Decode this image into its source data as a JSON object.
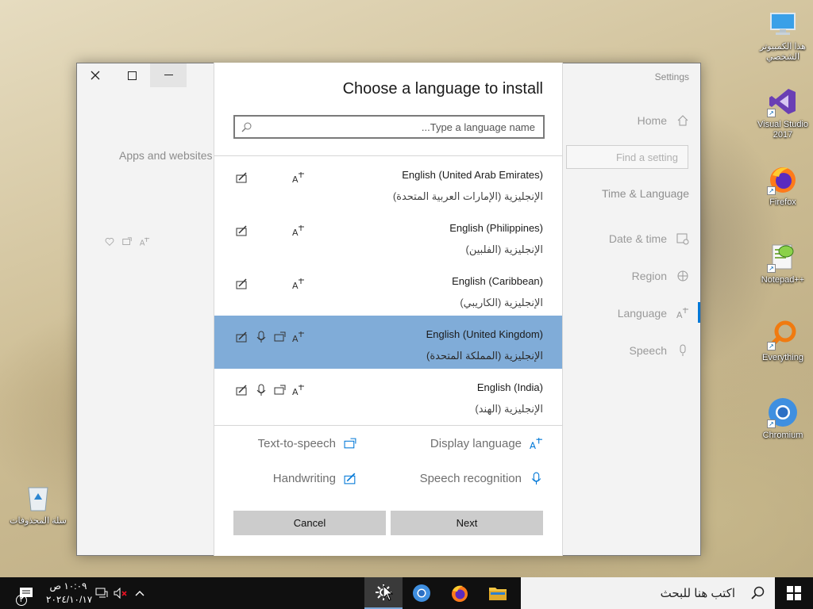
{
  "desktop": {
    "icons": [
      {
        "label": "هذا الكمبيوتر الشخصي",
        "icon": "computer-icon"
      },
      {
        "label": "Visual Studio 2017",
        "icon": "visual-studio-icon"
      },
      {
        "label": "Firefox",
        "icon": "firefox-icon"
      },
      {
        "label": "Notepad++",
        "icon": "notepadpp-icon"
      },
      {
        "label": "Everything",
        "icon": "everything-icon"
      },
      {
        "label": "Chromium",
        "icon": "chromium-icon"
      },
      {
        "label": "سلة المحذوفات",
        "icon": "recycle-bin-icon"
      }
    ]
  },
  "settings": {
    "title": "Settings",
    "home": "Home",
    "find_placeholder": "Find a setting",
    "category": "Time & Language",
    "nav": [
      "Date & time",
      "Region",
      "Language",
      "Speech"
    ],
    "apps_websites_text": "Apps and websites w"
  },
  "dialog": {
    "title": "Choose a language to install",
    "search_placeholder": "Type a language name...",
    "languages": [
      {
        "name": "English (United Arab Emirates)",
        "native": "الإنجليزية (الإمارات العربية المتحدة)",
        "features": [
          "handwriting",
          "display"
        ],
        "selected": false
      },
      {
        "name": "English (Philippines)",
        "native": "الإنجليزية (الفلبين)",
        "features": [
          "handwriting",
          "display"
        ],
        "selected": false
      },
      {
        "name": "English (Caribbean)",
        "native": "الإنجليزية (الكاريبي)",
        "features": [
          "handwriting",
          "display"
        ],
        "selected": false
      },
      {
        "name": "English (United Kingdom)",
        "native": "الإنجليزية (المملكة المتحدة)",
        "features": [
          "handwriting",
          "speech",
          "tts",
          "display"
        ],
        "selected": true
      },
      {
        "name": "English (India)",
        "native": "الإنجليزية (الهند)",
        "features": [
          "handwriting",
          "speech",
          "tts",
          "display"
        ],
        "selected": false
      }
    ],
    "legend": {
      "tts": "Text-to-speech",
      "display": "Display language",
      "handwriting": "Handwriting",
      "speech": "Speech recognition"
    },
    "cancel_label": "Cancel",
    "next_label": "Next",
    "accent_color": "#0078d7",
    "selected_color": "#80acd8"
  },
  "taskbar": {
    "search_placeholder": "اكتب هنا للبحث",
    "time": "١٠:٠٩ ص",
    "date": "٢٠٢٤/١٠/١٧",
    "notification_count": "٢"
  }
}
